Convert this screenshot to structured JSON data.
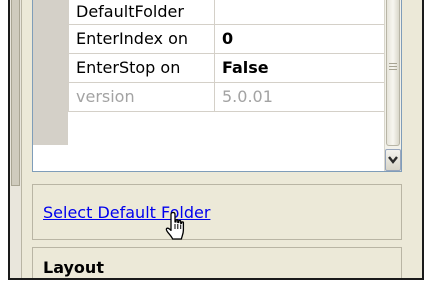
{
  "property_grid": {
    "rows": [
      {
        "name": "DefaultFolder",
        "value": "",
        "disabled": false
      },
      {
        "name": "EnterIndex on",
        "value": "0",
        "disabled": false
      },
      {
        "name": "EnterStop on",
        "value": "False",
        "disabled": false
      },
      {
        "name": "version",
        "value": "5.0.01",
        "disabled": true
      }
    ]
  },
  "tasks": {
    "link_label": "Select Default Folder"
  },
  "section": {
    "title": "Layout"
  },
  "icons": {
    "scroll_down": "chevron-down-icon",
    "cursor": "hand-pointer-icon",
    "grip": "scrollbar-grip-icon"
  },
  "colors": {
    "link": "#0000ee",
    "panel": "#ece9d8",
    "grid_border": "#7f9db9"
  }
}
